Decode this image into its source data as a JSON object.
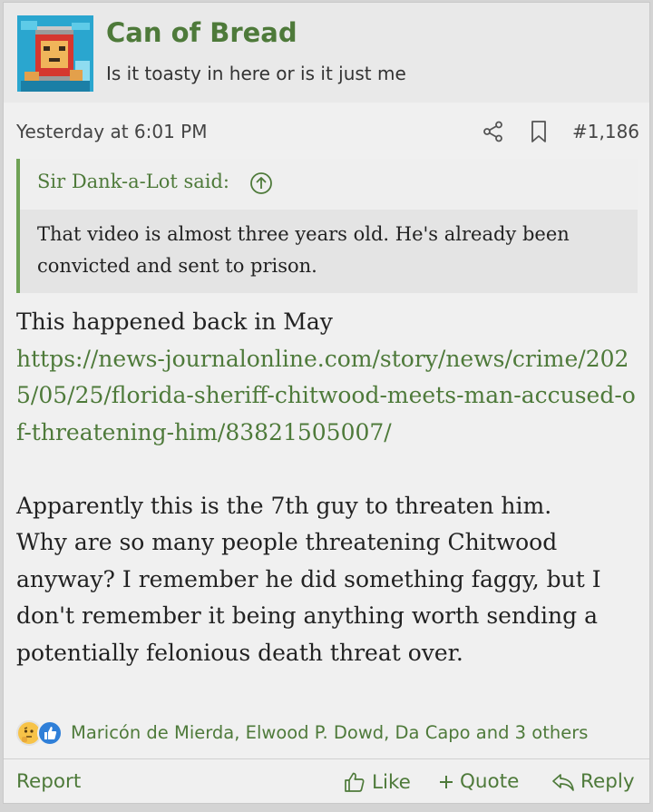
{
  "user": {
    "name": "Can of Bread",
    "title": "Is it toasty in here or is it just me"
  },
  "meta": {
    "timestamp": "Yesterday at 6:01 PM",
    "post_number": "#1,186"
  },
  "quote": {
    "author": "Sir Dank-a-Lot said:",
    "text": "That video is almost three years old. He's already been convicted and sent to prison."
  },
  "post": {
    "line1": "This happened back in May",
    "link": "https://news-journalonline.com/story/news/crime/2025/05/25/florida-sheriff-chitwood-meets-man-accused-of-threatening-him/83821505007/",
    "paragraph2": "Apparently this is the 7th guy to threaten him.",
    "paragraph3": "Why are so many people threatening Chitwood anyway? I remember he did something faggy, but I don't remember it being anything worth sending a potentially felonious death threat over."
  },
  "reactions": {
    "icons": [
      "thinking-face-icon",
      "thumbs-up-icon"
    ],
    "names": "Maricón de Mierda, Elwood P. Dowd, Da Capo and 3 others"
  },
  "footer": {
    "report": "Report",
    "like": "Like",
    "quote": "Quote",
    "reply": "Reply"
  },
  "colors": {
    "accent": "#4e7a3a",
    "quote_border": "#6fa256",
    "post_bg": "#f0f0f0",
    "header_bg": "#e9e9e9"
  }
}
